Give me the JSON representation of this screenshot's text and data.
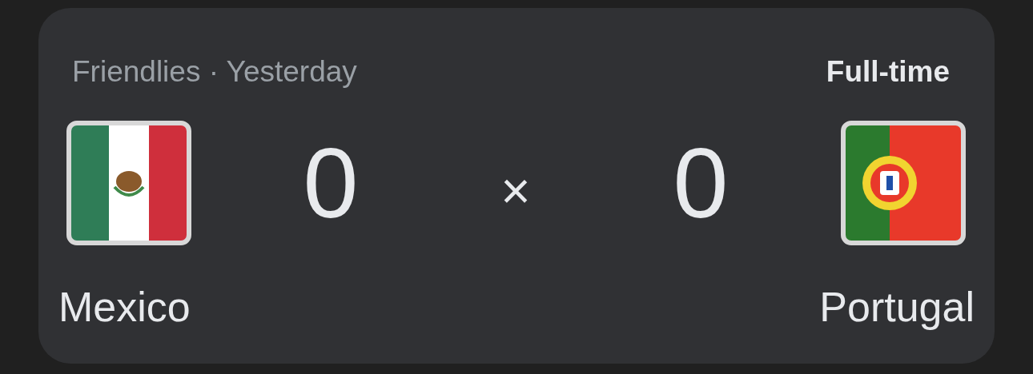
{
  "match": {
    "competition": "Friendlies · Yesterday",
    "status": "Full-time",
    "separator": "×",
    "home": {
      "name": "Mexico",
      "score": "0",
      "kind": "mexico"
    },
    "away": {
      "name": "Portugal",
      "score": "0",
      "kind": "portugal"
    }
  }
}
